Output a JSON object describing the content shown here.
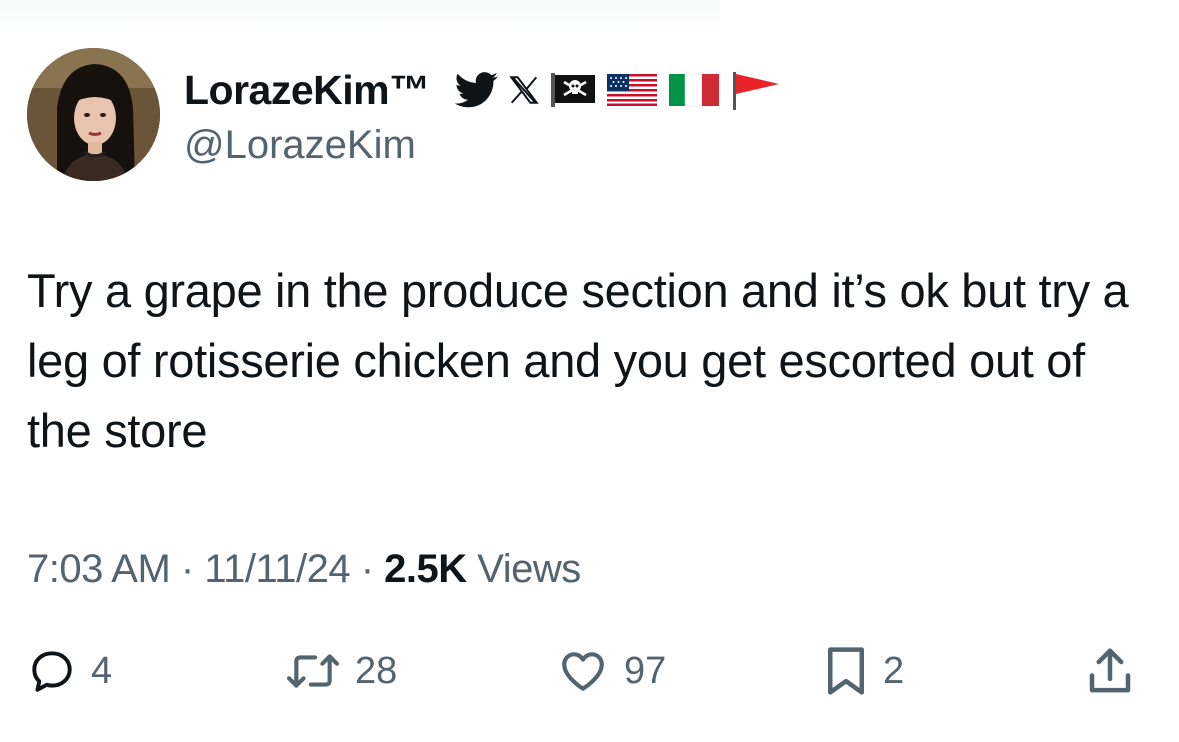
{
  "author": {
    "display_name": "LorazeKim™",
    "handle": "@LorazeKim",
    "avatar": "profile-photo",
    "badges": [
      "twitter-bird-icon",
      "x-logo-icon",
      "pirate-flag-icon",
      "us-flag-icon",
      "italy-flag-icon",
      "red-triangle-flag-icon"
    ]
  },
  "tweet": {
    "text": "Try a grape in the produce section and it’s ok but try a leg of rotisserie chicken and you get escorted out of the store"
  },
  "meta": {
    "time": "7:03 AM",
    "separator1": " · ",
    "date": "11/11/24",
    "separator2": " · ",
    "views_count": "2.5K",
    "views_label": " Views"
  },
  "actions": {
    "replies": "4",
    "retweets": "28",
    "likes": "97",
    "bookmarks": "2"
  },
  "colors": {
    "text_primary": "#0f1419",
    "text_secondary": "#536471",
    "twitter_blue": "#1d9bf0"
  }
}
